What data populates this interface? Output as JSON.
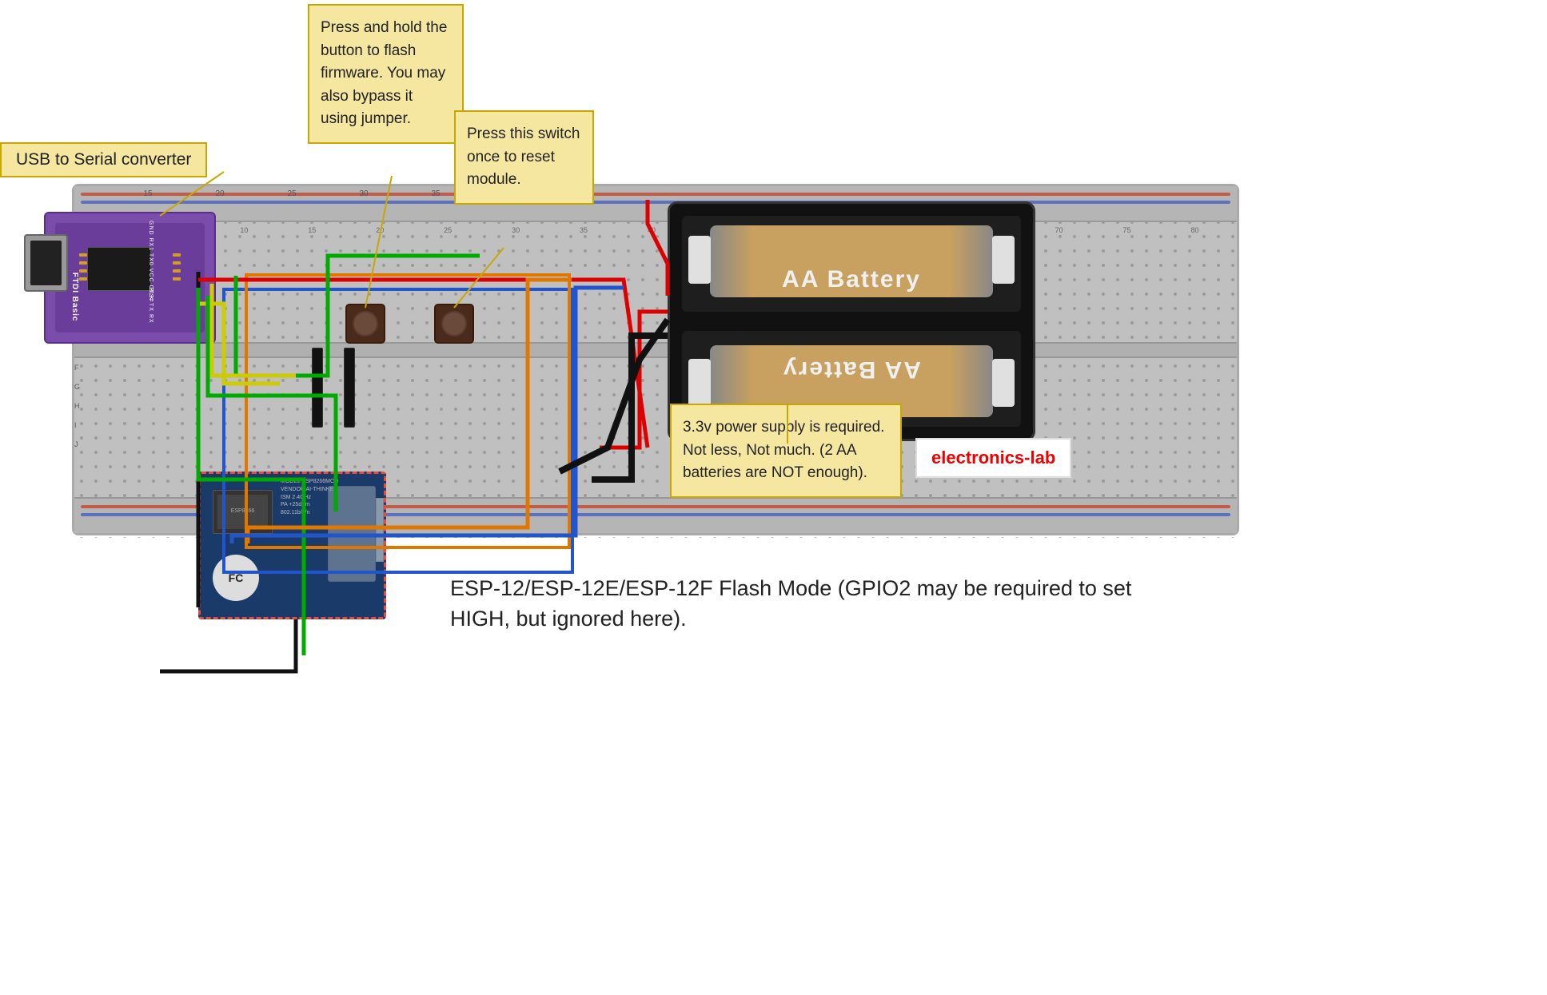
{
  "annotations": {
    "usb_converter": "USB to Serial converter",
    "flash_button": "Press and hold the button to flash firmware. You may also bypass it using jumper.",
    "reset_button": "Press this switch once to reset module.",
    "power_supply": "3.3v power supply is required. Not less, Not much. (2 AA batteries are NOT enough).",
    "flash_mode": "ESP-12/ESP-12E/ESP-12F Flash Mode (GPIO2 may be required to set HIGH, but ignored here).",
    "electronics_lab": "electronics-lab"
  },
  "colors": {
    "breadboard_bg": "#c8c8c8",
    "ftdi_purple": "#6a3d9a",
    "esp_blue": "#1a3a6a",
    "battery_black": "#1a1a1a",
    "annotation_bg": "#f5e6a0",
    "annotation_border": "#c8a800",
    "wire_black": "#111111",
    "wire_red": "#dd0000",
    "wire_green": "#00aa00",
    "wire_yellow": "#dddd00",
    "wire_orange": "#e07800",
    "wire_blue": "#2255cc",
    "badge_red": "#ee0000",
    "accent_orange": "#e07800"
  },
  "battery": {
    "label_top": "AA Battery",
    "label_bottom": "AA Battery"
  },
  "ftdi": {
    "label": "FTDI Basic"
  },
  "esp": {
    "model_text": "MODEL ESP8266MOD\nVENDOR AI-THINKER\nISM 2.4GHz\nPA +25dBm\n802.11b/g/n"
  }
}
